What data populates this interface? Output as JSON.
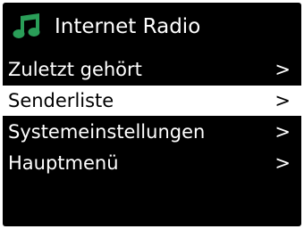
{
  "header": {
    "title": "Internet Radio",
    "icon": "music-note-icon",
    "icon_color": "#2a9e58"
  },
  "menu": {
    "items": [
      {
        "label": "Zuletzt gehört",
        "arrow": ">",
        "selected": false
      },
      {
        "label": "Senderliste",
        "arrow": ">",
        "selected": true
      },
      {
        "label": "Systemeinstellungen",
        "arrow": ">",
        "selected": false
      },
      {
        "label": "Hauptmenü",
        "arrow": ">",
        "selected": false
      }
    ]
  },
  "colors": {
    "background": "#000000",
    "foreground": "#ffffff",
    "selection_background": "#ffffff",
    "selection_foreground": "#000000"
  }
}
